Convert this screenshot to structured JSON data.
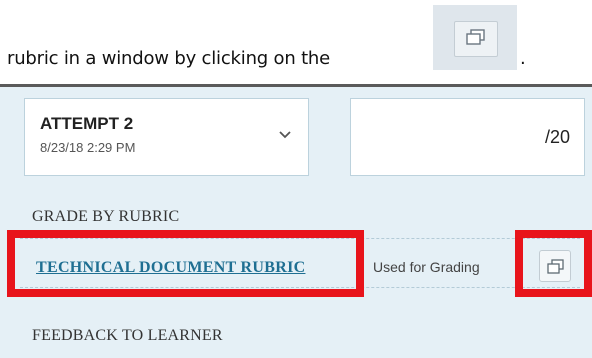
{
  "instruction": {
    "text": "rubric in a window by clicking on the",
    "period": ".",
    "icon": "open-in-window-icon"
  },
  "attempt": {
    "title": "ATTEMPT 2",
    "date": "8/23/18 2:29 PM",
    "dropdown_icon": "chevron-down-icon"
  },
  "grade": {
    "score": "/20"
  },
  "rubric_section": {
    "heading": "GRADE BY RUBRIC",
    "link": "TECHNICAL DOCUMENT RUBRIC",
    "status": "Used for Grading",
    "open_icon": "open-in-window-icon"
  },
  "feedback_section": {
    "heading": "FEEDBACK TO LEARNER"
  },
  "colors": {
    "panel_bg": "#e5f0f6",
    "link": "#1f6f92",
    "highlight": "#e8141b"
  }
}
